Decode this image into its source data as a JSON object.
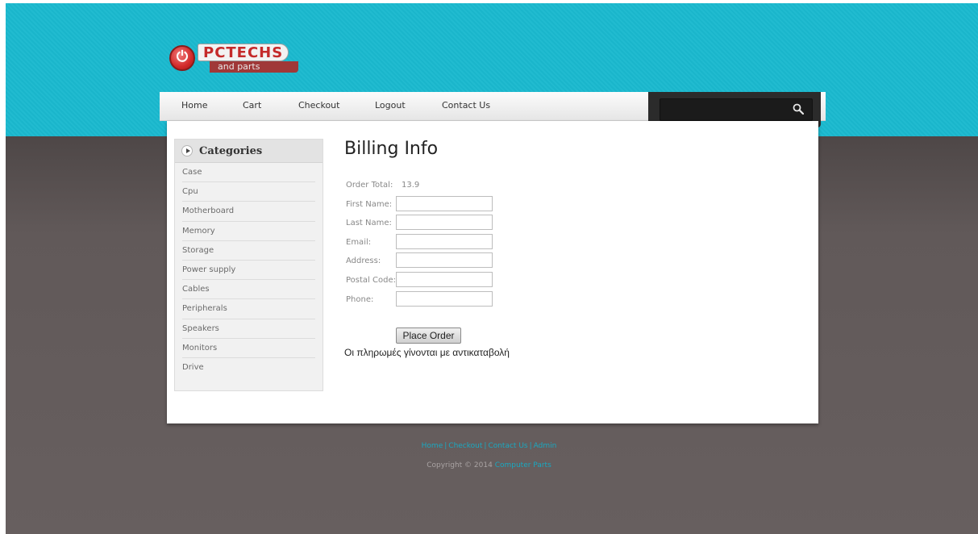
{
  "logo": {
    "brand": "PCTECHS",
    "tagline": "and parts"
  },
  "nav": {
    "items": [
      "Home",
      "Cart",
      "Checkout",
      "Logout",
      "Contact Us"
    ]
  },
  "search": {
    "placeholder": ""
  },
  "sidebar": {
    "title": "Categories",
    "items": [
      "Case",
      "Cpu",
      "Motherboard",
      "Memory",
      "Storage",
      "Power supply",
      "Cables",
      "Peripherals",
      "Speakers",
      "Monitors",
      "Drive"
    ]
  },
  "billing": {
    "title": "Billing Info",
    "order_total_label": "Order Total:",
    "order_total_value": "13.9",
    "fields": [
      {
        "label": "First Name:",
        "value": ""
      },
      {
        "label": "Last Name:",
        "value": ""
      },
      {
        "label": "Email:",
        "value": ""
      },
      {
        "label": "Address:",
        "value": ""
      },
      {
        "label": "Postal Code:",
        "value": ""
      },
      {
        "label": "Phone:",
        "value": ""
      }
    ],
    "submit_label": "Place Order",
    "note": "Οι πληρωμές γίνονται με αντικαταβολή"
  },
  "footer": {
    "links": [
      "Home",
      "Checkout",
      "Contact Us",
      "Admin"
    ],
    "copyright_prefix": "Copyright © 2014",
    "copyright_link": "Computer Parts"
  },
  "colors": {
    "accent": "#1ab9cf",
    "link": "#1aa8c0",
    "bottom_bg": "#615959"
  }
}
